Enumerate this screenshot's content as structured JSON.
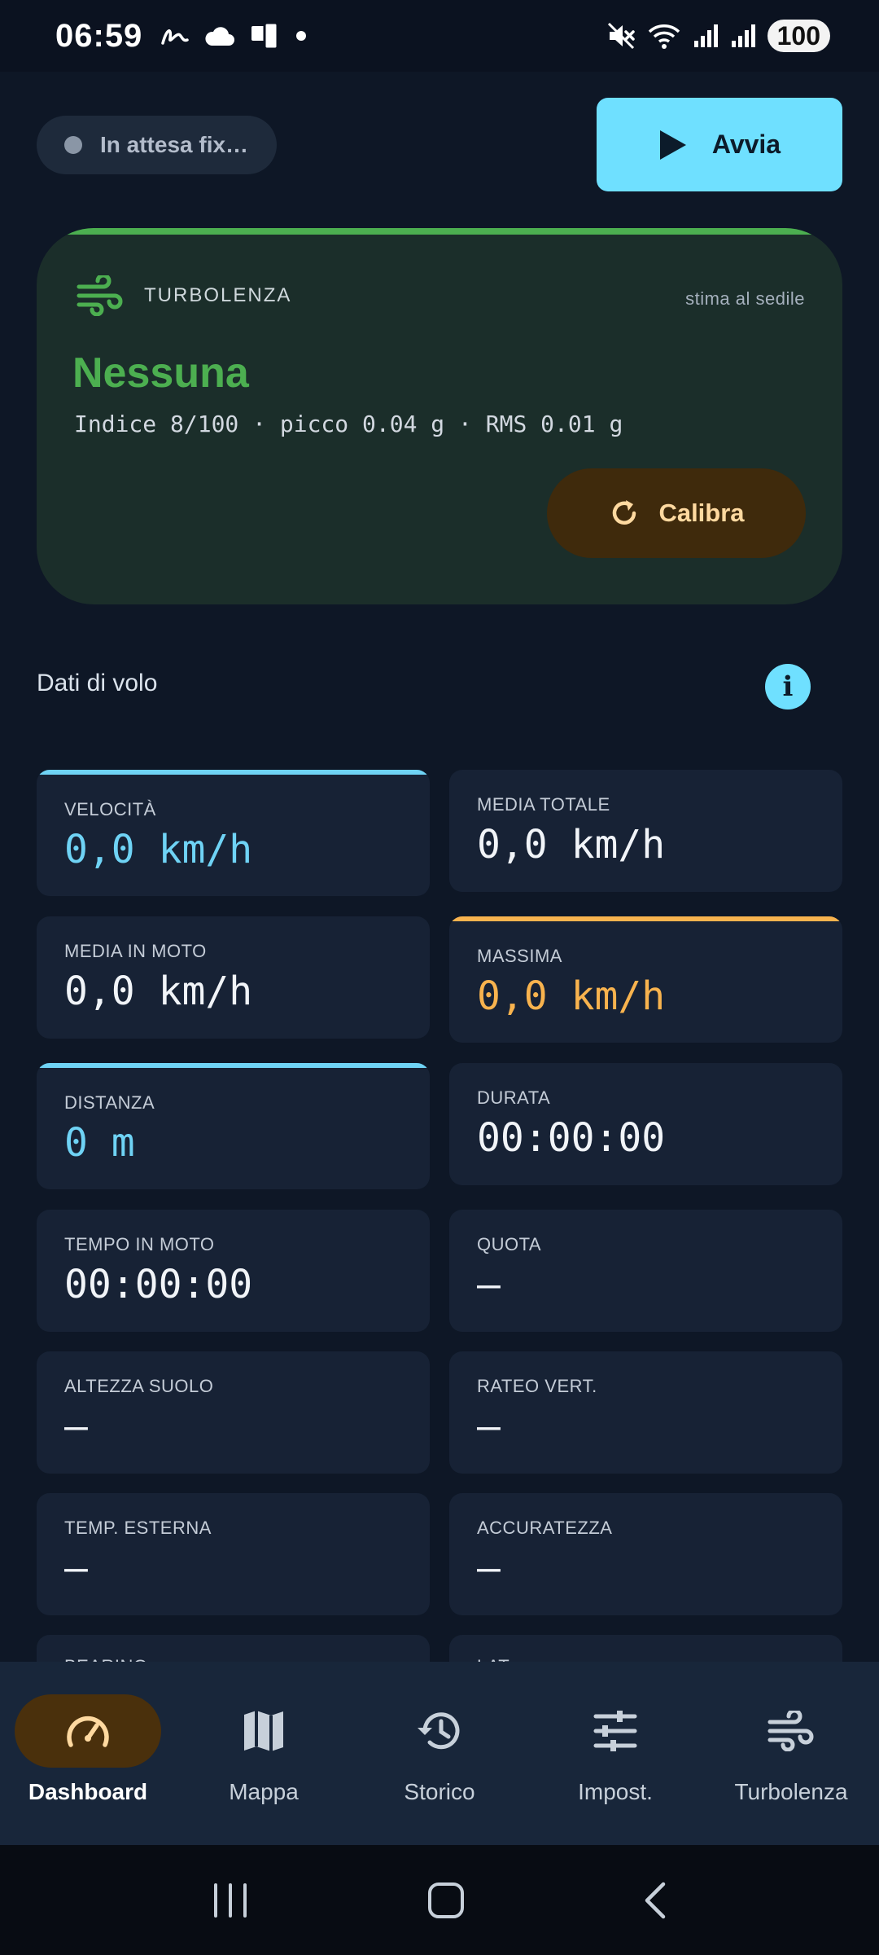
{
  "status_bar": {
    "time": "06:59",
    "battery": "100"
  },
  "top": {
    "fix_status": "In attesa fix…",
    "start_label": "Avvia"
  },
  "turbulence": {
    "label": "TURBOLENZA",
    "hint": "stima al sedile",
    "level": "Nessuna",
    "stats": "Indice 8/100 · picco 0.04 g · RMS 0.01 g",
    "calibrate_label": "Calibra",
    "accent_color": "#4caf50"
  },
  "flight_data": {
    "title": "Dati di volo",
    "info_glyph": "i",
    "metrics": [
      {
        "label": "VELOCITÀ",
        "value": "0,0 km/h"
      },
      {
        "label": "MEDIA TOTALE",
        "value": "0,0 km/h"
      },
      {
        "label": "MEDIA IN MOTO",
        "value": "0,0 km/h"
      },
      {
        "label": "MASSIMA",
        "value": "0,0 km/h"
      },
      {
        "label": "DISTANZA",
        "value": "0 m"
      },
      {
        "label": "DURATA",
        "value": "00:00:00"
      },
      {
        "label": "TEMPO IN MOTO",
        "value": "00:00:00"
      },
      {
        "label": "QUOTA",
        "value": "—"
      },
      {
        "label": "ALTEZZA SUOLO",
        "value": "—"
      },
      {
        "label": "RATEO VERT.",
        "value": "—"
      },
      {
        "label": "TEMP. ESTERNA",
        "value": "—"
      },
      {
        "label": "ACCURATEZZA",
        "value": "—"
      },
      {
        "label": "BEARING",
        "value": ""
      },
      {
        "label": "LAT",
        "value": ""
      }
    ]
  },
  "nav": {
    "items": [
      {
        "label": "Dashboard",
        "icon": "speedometer-icon"
      },
      {
        "label": "Mappa",
        "icon": "map-icon"
      },
      {
        "label": "Storico",
        "icon": "history-icon"
      },
      {
        "label": "Impost.",
        "icon": "sliders-icon"
      },
      {
        "label": "Turbolenza",
        "icon": "wind-icon"
      }
    ],
    "active": "Dashboard"
  },
  "colors": {
    "accent_cyan": "#6fe0ff",
    "accent_orange": "#f8b34e",
    "accent_green": "#4caf50"
  }
}
